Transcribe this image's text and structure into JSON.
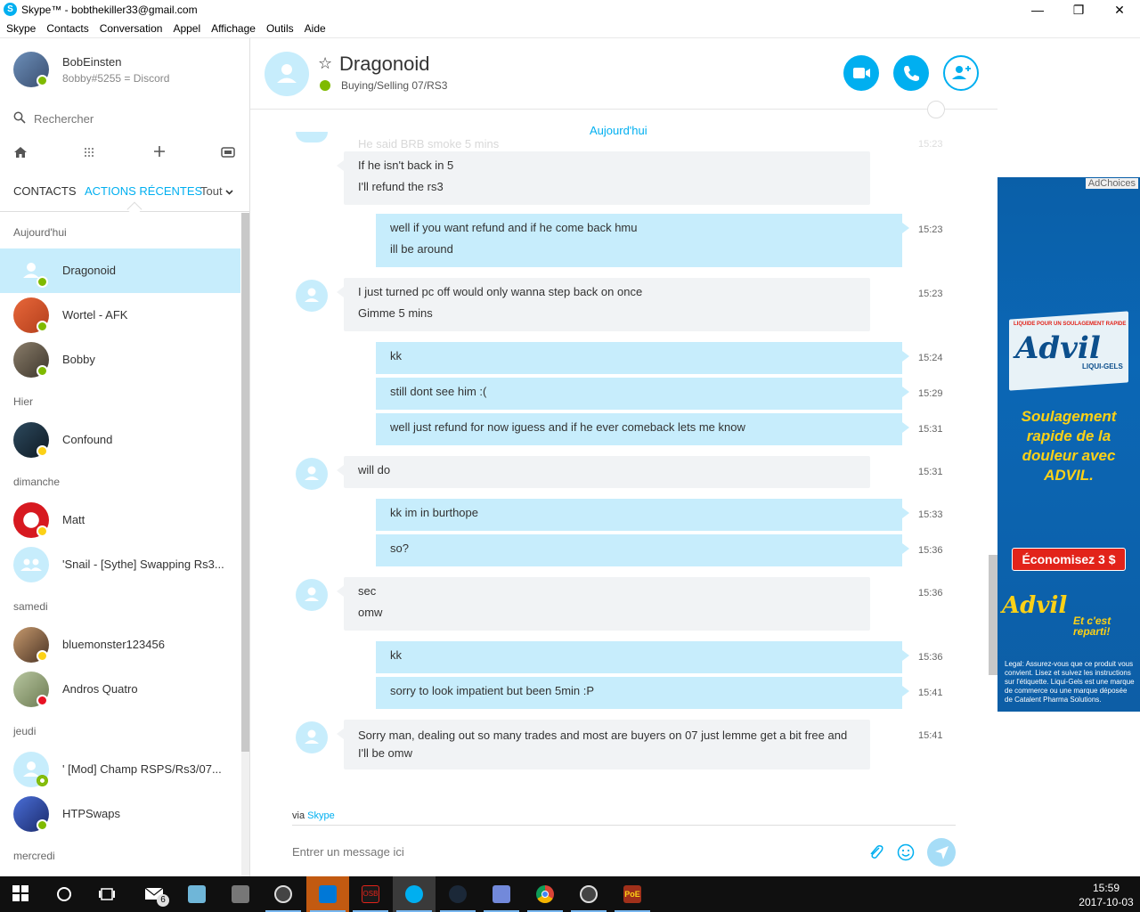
{
  "window": {
    "title": "Skype™ - bobthekiller33@gmail.com",
    "app_icon": "S",
    "minimize": "—",
    "maximize": "❐",
    "close": "✕"
  },
  "menu": [
    "Skype",
    "Contacts",
    "Conversation",
    "Appel",
    "Affichage",
    "Outils",
    "Aide"
  ],
  "profile": {
    "name": "BobEinsten",
    "mood": "8obby#5255 = Discord"
  },
  "search": {
    "placeholder": "Rechercher"
  },
  "toolbar_icons": [
    "home-icon",
    "dialpad-icon",
    "add-icon",
    "new-contact-icon"
  ],
  "tabs": {
    "contacts": "CONTACTS",
    "recent": "ACTIONS RÉCENTES",
    "all": "Tout"
  },
  "groups": [
    {
      "label": "Aujourd'hui",
      "contacts": [
        {
          "name": "Dragonoid",
          "status": "online",
          "selected": true
        },
        {
          "name": "Wortel - AFK",
          "status": "online"
        },
        {
          "name": "Bobby",
          "status": "online"
        }
      ]
    },
    {
      "label": "Hier",
      "contacts": [
        {
          "name": "Confound",
          "status": "away"
        }
      ]
    },
    {
      "label": "dimanche",
      "contacts": [
        {
          "name": "Matt",
          "status": "away"
        },
        {
          "name": "'Snail - [Sythe] Swapping Rs3...",
          "status": "group"
        }
      ]
    },
    {
      "label": "samedi",
      "contacts": [
        {
          "name": "bluemonster123456",
          "status": "away"
        },
        {
          "name": "Andros Quatro",
          "status": "dnd"
        }
      ]
    },
    {
      "label": "jeudi",
      "contacts": [
        {
          "name": "' [Mod] Champ RSPS/Rs3/07...",
          "status": "offline"
        },
        {
          "name": "HTPSwaps",
          "status": "online"
        }
      ]
    },
    {
      "label": "mercredi",
      "contacts": []
    }
  ],
  "chat": {
    "name": "Dragonoid",
    "mood": "Buying/Selling 07/RS3",
    "star": "☆",
    "date_separator": "Aujourd'hui",
    "ghost_text": "He said BRB smoke 5 mins",
    "ghost_time": "15:23",
    "messages": [
      {
        "dir": "in",
        "lines": [
          "If he isn't back in 5",
          "I'll refund the rs3"
        ],
        "time": ""
      },
      {
        "dir": "out",
        "lines": [
          "well if you want refund and if he come back hmu",
          "ill be around"
        ],
        "time": "15:23"
      },
      {
        "dir": "in",
        "lines": [
          "I just turned pc off would only wanna step back on once",
          "Gimme 5 mins"
        ],
        "time": "15:23"
      },
      {
        "dir": "out",
        "lines": [
          "kk"
        ],
        "time": "15:24"
      },
      {
        "dir": "out",
        "lines": [
          "still dont see him :("
        ],
        "time": "15:29"
      },
      {
        "dir": "out",
        "lines": [
          "well just refund for now iguess and if he ever comeback lets me know"
        ],
        "time": "15:31"
      },
      {
        "dir": "in",
        "lines": [
          "will do"
        ],
        "time": "15:31"
      },
      {
        "dir": "out",
        "lines": [
          "kk im in burthope"
        ],
        "time": "15:33"
      },
      {
        "dir": "out",
        "lines": [
          "so?"
        ],
        "time": "15:36"
      },
      {
        "dir": "in",
        "lines": [
          "sec",
          "omw"
        ],
        "time": "15:36"
      },
      {
        "dir": "out",
        "lines": [
          "kk"
        ],
        "time": "15:36"
      },
      {
        "dir": "out",
        "lines": [
          "sorry to look impatient but been 5min :P"
        ],
        "time": "15:41"
      },
      {
        "dir": "in",
        "lines": [
          "Sorry man, dealing out so many trades and most are buyers on 07 just lemme get a bit free and I'll be omw"
        ],
        "time": "15:41"
      }
    ],
    "via_prefix": "via",
    "via_link": "Skype",
    "composer_placeholder": "Entrer un message ici"
  },
  "ad": {
    "choices": "AdChoices",
    "small_text": "LIQUIDE POUR UN SOULAGEMENT RAPIDE",
    "brand": "Advil",
    "product": "LIQUI-GELS",
    "headline": "Soulagement rapide de la douleur avec ADVIL.",
    "cta": "Économisez 3 $",
    "tagline": "Et c'est reparti!",
    "legal": "Legal: Assurez-vous que ce produit vous convient. Lisez et suivez les instructions sur l'étiquette. Liqui-Gels est une marque de commerce ou une marque déposée de Catalent Pharma Solutions."
  },
  "taskbar": {
    "time": "15:59",
    "date": "2017-10-03",
    "mail_badge": "6",
    "apps": [
      "windows-start-icon",
      "cortana-icon",
      "task-view-icon",
      "mail-icon",
      "notepad-icon",
      "calculator-icon",
      "runelite-icon",
      "edge-icon",
      "osbuddy-icon",
      "skype-icon",
      "steam-icon",
      "discord-icon",
      "chrome-icon",
      "runelite-icon-2",
      "poe-icon"
    ],
    "osb_label": "OSB",
    "poe_label": "PoE"
  }
}
